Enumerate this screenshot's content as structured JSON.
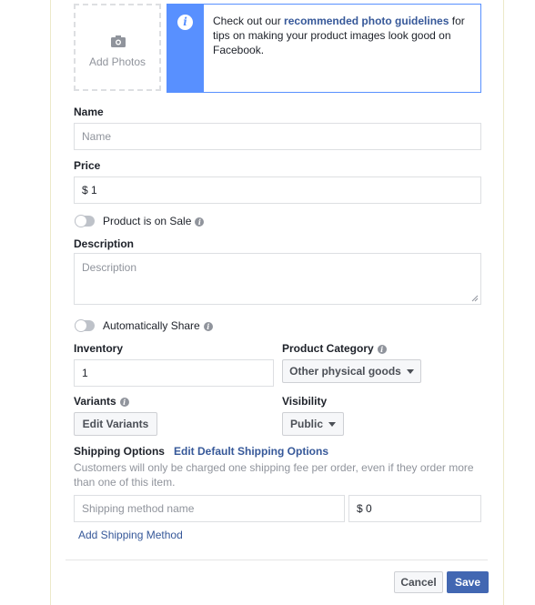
{
  "photos": {
    "add_label": "Add Photos"
  },
  "tip": {
    "text_before": "Check out our ",
    "link": "recommended photo guidelines",
    "text_after": " for tips on making your product images look good on Facebook."
  },
  "name": {
    "label": "Name",
    "placeholder": "Name"
  },
  "price": {
    "label": "Price",
    "value": "$ 1"
  },
  "sale": {
    "label": "Product is on Sale",
    "on": false
  },
  "description": {
    "label": "Description",
    "placeholder": "Description"
  },
  "share": {
    "label": "Automatically Share",
    "on": false
  },
  "inventory": {
    "label": "Inventory",
    "value": "1"
  },
  "category": {
    "label": "Product Category",
    "value": "Other physical goods"
  },
  "variants": {
    "label": "Variants",
    "button": "Edit Variants"
  },
  "visibility": {
    "label": "Visibility",
    "value": "Public"
  },
  "shipping": {
    "label": "Shipping Options",
    "edit_link": "Edit Default Shipping Options",
    "note": "Customers will only be charged one shipping fee per order, even if they order more than one of this item.",
    "method_placeholder": "Shipping method name",
    "price_value": "$ 0",
    "add_link": "Add Shipping Method"
  },
  "footer": {
    "cancel": "Cancel",
    "save": "Save"
  },
  "colors": {
    "accent": "#5890ff",
    "link": "#365899",
    "primary": "#4267b2"
  }
}
